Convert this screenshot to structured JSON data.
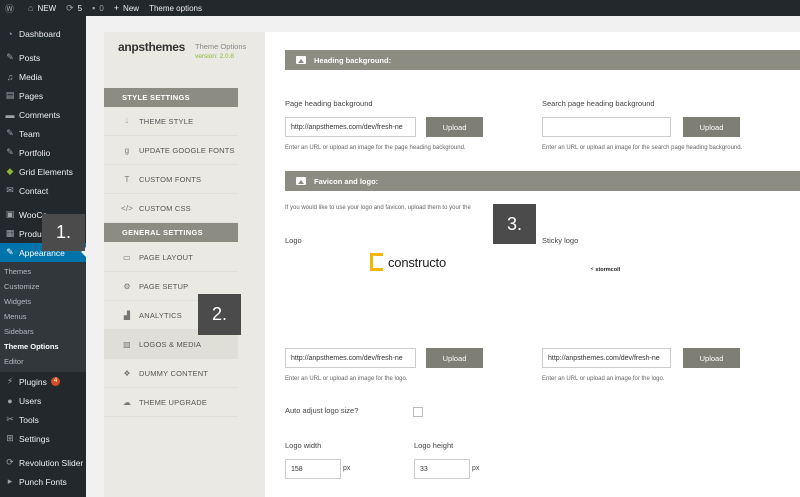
{
  "adminbar": {
    "site_name": "NEW",
    "updates_count": "5",
    "comments_count": "0",
    "new_label": "New",
    "theme_options_label": "Theme options"
  },
  "adminmenu": {
    "items": [
      {
        "label": "Dashboard"
      },
      {
        "label": "Posts"
      },
      {
        "label": "Media"
      },
      {
        "label": "Pages"
      },
      {
        "label": "Comments"
      },
      {
        "label": "Team"
      },
      {
        "label": "Portfolio"
      },
      {
        "label": "Grid Elements"
      },
      {
        "label": "Contact"
      },
      {
        "label": "WooCo"
      },
      {
        "label": "Produ"
      },
      {
        "label": "Appearance"
      },
      {
        "label": "Plugins",
        "badge": "4"
      },
      {
        "label": "Users"
      },
      {
        "label": "Tools"
      },
      {
        "label": "Settings"
      },
      {
        "label": "Revolution Slider"
      },
      {
        "label": "Punch Fonts"
      }
    ],
    "appearance_submenu": [
      "Themes",
      "Customize",
      "Widgets",
      "Menus",
      "Sidebars",
      "Theme Options",
      "Editor"
    ]
  },
  "theme_panel": {
    "brand": "anpsthemes",
    "subtitle": "Theme Options",
    "version": "version: 2.0.8",
    "style_settings_heading": "STYLE SETTINGS",
    "style_items": [
      "THEME STYLE",
      "UPDATE GOOGLE FONTS",
      "CUSTOM FONTS",
      "CUSTOM CSS"
    ],
    "general_settings_heading": "GENERAL SETTINGS",
    "general_items": [
      "PAGE LAYOUT",
      "PAGE SETUP",
      "ANALYTICS",
      "LOGOS & MEDIA",
      "DUMMY CONTENT",
      "THEME UPGRADE"
    ]
  },
  "main": {
    "heading_bg": {
      "title": "Heading background:",
      "page_label": "Page heading background",
      "page_value": "http://anpsthemes.com/dev/fresh-ne",
      "page_help": "Enter an URL or upload an image for the page heading background.",
      "search_label": "Search page heading background",
      "search_value": "",
      "search_help": "Enter an URL or upload an image for the search page heading background.",
      "upload_label": "Upload"
    },
    "favicon_logo": {
      "title": "Favicon and logo:",
      "intro": "If you would like to use your logo and favicon, upload them to your the",
      "logo_label": "Logo",
      "sticky_logo_label": "Sticky logo",
      "logo_value": "http://anpsthemes.com/dev/fresh-ne",
      "logo_help": "Enter an URL or upload an image for the logo.",
      "sticky_value": "http://anpsthemes.com/dev/fresh-ne",
      "sticky_help": "Enter an URL or upload an image for the logo.",
      "upload_label": "Upload",
      "auto_adjust_label": "Auto adjust logo size?",
      "logo_width_label": "Logo width",
      "logo_width_value": "158",
      "logo_height_label": "Logo height",
      "logo_height_value": "33",
      "unit": "px"
    },
    "logo_constructo_text": "constructo",
    "logo_stormcoll_text": "stormcoll"
  },
  "callouts": [
    "1.",
    "2.",
    "3."
  ],
  "colors": {
    "adminbar_bg": "#23282d",
    "menu_active": "#0073aa",
    "section_head": "#8c8c83",
    "button": "#7f7e75",
    "logo_accent": "#f2b705",
    "version_green": "#8ab933"
  }
}
